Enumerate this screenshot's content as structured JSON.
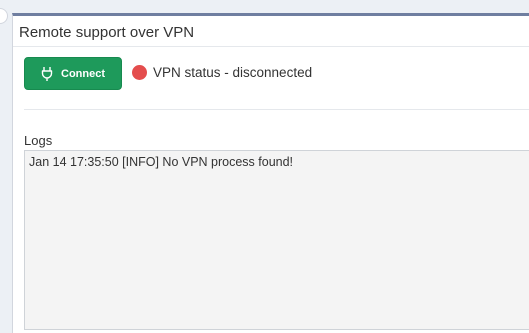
{
  "panel": {
    "title": "Remote support over VPN"
  },
  "actions": {
    "connect_label": "Connect",
    "connect_icon": "plug-icon",
    "button_color": "#1e9a5b"
  },
  "status": {
    "text": "VPN status - disconnected",
    "indicator_color": "#e44d4d",
    "state": "disconnected"
  },
  "logs": {
    "label": "Logs",
    "content": "Jan 14 17:35:50 [INFO] No VPN process found!"
  }
}
